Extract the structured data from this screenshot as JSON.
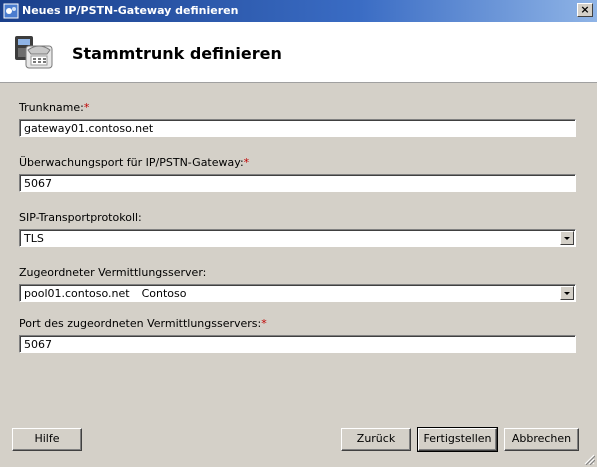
{
  "window": {
    "title": "Neues IP/PSTN-Gateway definieren",
    "close_glyph": "×"
  },
  "header": {
    "heading": "Stammtrunk definieren",
    "icon": "phone-gateway-icon"
  },
  "fields": {
    "trunk_name": {
      "label": "Trunkname:",
      "required_mark": "*",
      "value": "gateway01.contoso.net"
    },
    "listen_port": {
      "label": "Überwachungsport für IP/PSTN-Gateway:",
      "required_mark": "*",
      "value": "5067"
    },
    "sip_transport": {
      "label": "SIP-Transportprotokoll:",
      "value": "TLS"
    },
    "mediation_server": {
      "label": "Zugeordneter Vermittlungsserver:",
      "value": "pool01.contoso.net",
      "site": "Contoso"
    },
    "mediation_port": {
      "label": "Port des zugeordneten Vermittlungsservers:",
      "required_mark": "*",
      "value": "5067"
    }
  },
  "buttons": {
    "help": "Hilfe",
    "back": "Zurück",
    "finish": "Fertigstellen",
    "cancel": "Abbrechen"
  },
  "colors": {
    "titlebar_start": "#1a3f8a",
    "dialog_bg": "#d4d0c8",
    "required": "#c00000"
  }
}
